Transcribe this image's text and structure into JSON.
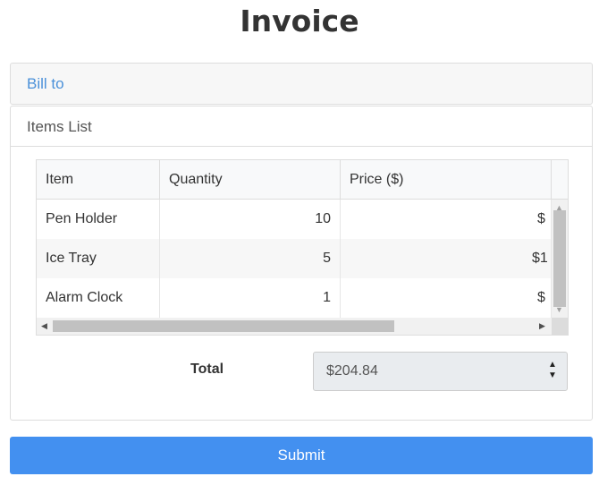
{
  "page": {
    "title": "Invoice"
  },
  "bill_to": {
    "label": "Bill to"
  },
  "items_list": {
    "label": "Items List",
    "columns": [
      "Item",
      "Quantity",
      "Price ($)"
    ],
    "rows": [
      {
        "item": "Pen Holder",
        "quantity": "10",
        "price_partial": "$"
      },
      {
        "item": "Ice Tray",
        "quantity": "5",
        "price_partial": "$1"
      },
      {
        "item": "Alarm Clock",
        "quantity": "1",
        "price_partial": "$"
      }
    ]
  },
  "total": {
    "label": "Total",
    "value": "$204.84"
  },
  "submit": {
    "label": "Submit"
  },
  "colors": {
    "accent": "#4390f0",
    "link": "#4a90d9"
  }
}
